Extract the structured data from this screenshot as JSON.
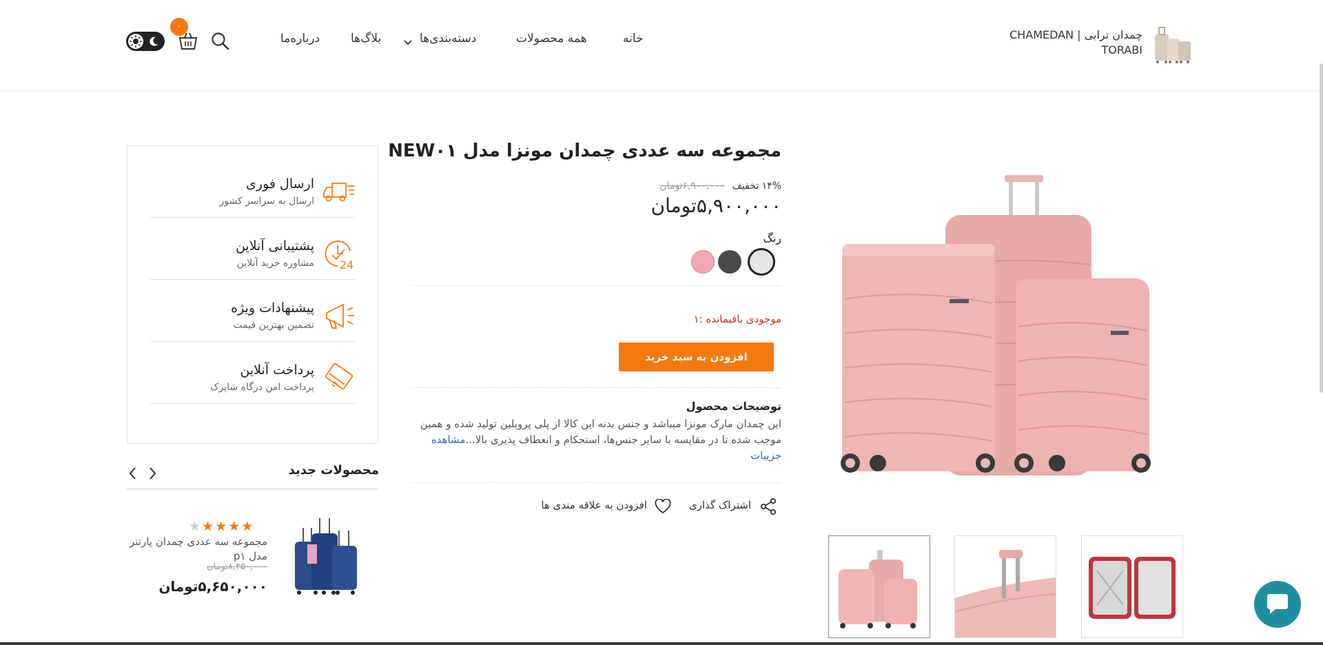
{
  "header": {
    "brand": "چمدان ترابی | CHAMEDAN TORABI",
    "nav": {
      "home": "خانه",
      "all_products": "همه محصولات",
      "categories": "دسته‌بندی‌ها",
      "blogs": "بلاگ‌ها",
      "about": "درباره‌ما"
    },
    "cart_count": "۰",
    "accent_color": "#f47a10"
  },
  "product": {
    "title": "مجموعه سه عددی چمدان مونزا مدل NEW۰۱",
    "old_price": "۶,۹۰۰,۰۰۰تومان",
    "discount": "۱۴% تخفیف",
    "price": "۵,۹۰۰,۰۰۰تومان",
    "color_label": "رنگ",
    "colors": [
      "#e6e6e6",
      "#4a4a4a",
      "#f4a7b3"
    ],
    "stock": "موجودی باقیمانده :۱",
    "add_to_cart": "افزودن به سبد خرید",
    "description_title": "توضیحات محصول",
    "description": "این چمدان مارک مونزا میباشد و جنس بدنه این کالا از پلی پروبلین تولید شده و همین موجب شده تا در مقایسه با سایر جنس‌ها، استحکام و انعطاف پذیری بالا...",
    "see_details": "مشاهده جزییات",
    "share": "اشتراک گذاری",
    "wishlist": "افزودن به علاقه مندی ها"
  },
  "features": [
    {
      "title": "ارسال فوری",
      "subtitle": "ارسال به سراسر کشور",
      "icon": "truck-icon"
    },
    {
      "title": "پشتیبانی آنلاین",
      "subtitle": "مشاوره خرید آنلاین",
      "icon": "support-24-icon"
    },
    {
      "title": "پیشنهادات ویژه",
      "subtitle": "تضمین بهترین قیمت",
      "icon": "megaphone-icon"
    },
    {
      "title": "پرداخت آنلاین",
      "subtitle": "پرداخت امن درگاه شاپرک",
      "icon": "card-icon"
    }
  ],
  "new_products": {
    "title": "محصولات جدید",
    "items": [
      {
        "name": "مجموعه سه عددی چمدان پارتنر مدل p۱",
        "old_price": "۸,۴۵۰,۰۰۰تومان",
        "price": "۵,۶۵۰,۰۰۰تومان",
        "rating": 4
      }
    ]
  }
}
